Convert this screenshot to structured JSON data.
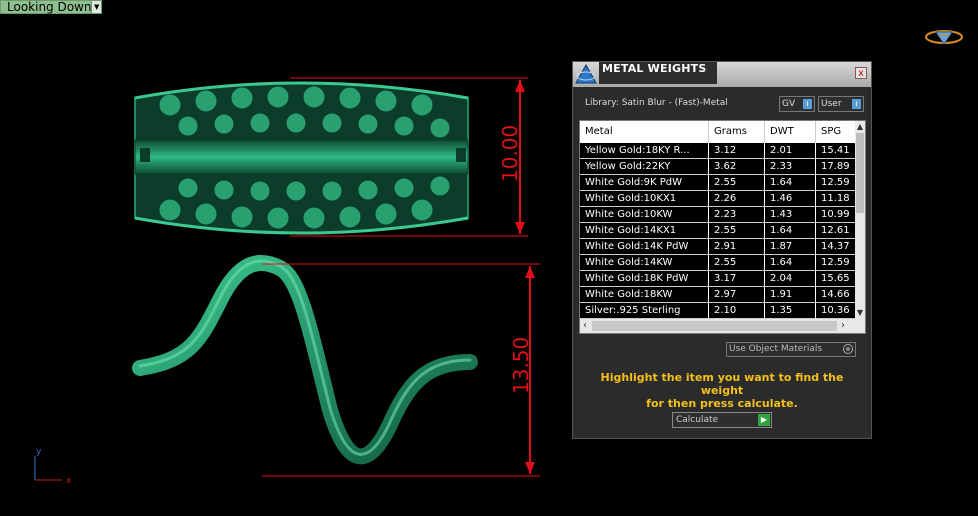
{
  "view_dropdown": {
    "label": "Looking Down"
  },
  "dimensions": {
    "ring_width": "10.00",
    "ring_height": "13.50"
  },
  "axes": {
    "x": "x",
    "y": "y"
  },
  "panel": {
    "title": "METAL WEIGHTS",
    "close_glyph": "x",
    "library_label": "Library: Satin Blur - (Fast)-Metal",
    "toggle_gv": "GV",
    "toggle_user": "User",
    "columns": [
      "Metal",
      "Grams",
      "DWT",
      "SPG"
    ],
    "rows": [
      [
        "Yellow Gold:18KY R...",
        "3.12",
        "2.01",
        "15.41"
      ],
      [
        "Yellow Gold:22KY",
        "3.62",
        "2.33",
        "17.89"
      ],
      [
        "White Gold:9K PdW",
        "2.55",
        "1.64",
        "12.59"
      ],
      [
        "White Gold:10KX1",
        "2.26",
        "1.46",
        "11.18"
      ],
      [
        "White Gold:10KW",
        "2.23",
        "1.43",
        "10.99"
      ],
      [
        "White Gold:14KX1",
        "2.55",
        "1.64",
        "12.61"
      ],
      [
        "White Gold:14K PdW",
        "2.91",
        "1.87",
        "14.37"
      ],
      [
        "White Gold:14KW",
        "2.55",
        "1.64",
        "12.59"
      ],
      [
        "White Gold:18K PdW",
        "3.17",
        "2.04",
        "15.65"
      ],
      [
        "White Gold:18KW",
        "2.97",
        "1.91",
        "14.66"
      ],
      [
        "Silver:.925 Sterling",
        "2.10",
        "1.35",
        "10.36"
      ]
    ],
    "use_materials": "Use Object Materials",
    "instructions_line1": "Highlight the item you want to find the weight",
    "instructions_line2": "for then press calculate.",
    "calculate": "Calculate"
  },
  "colors": {
    "dimension": "#e0101a",
    "model": "#1e8a5e",
    "instructions": "#f2c019"
  }
}
